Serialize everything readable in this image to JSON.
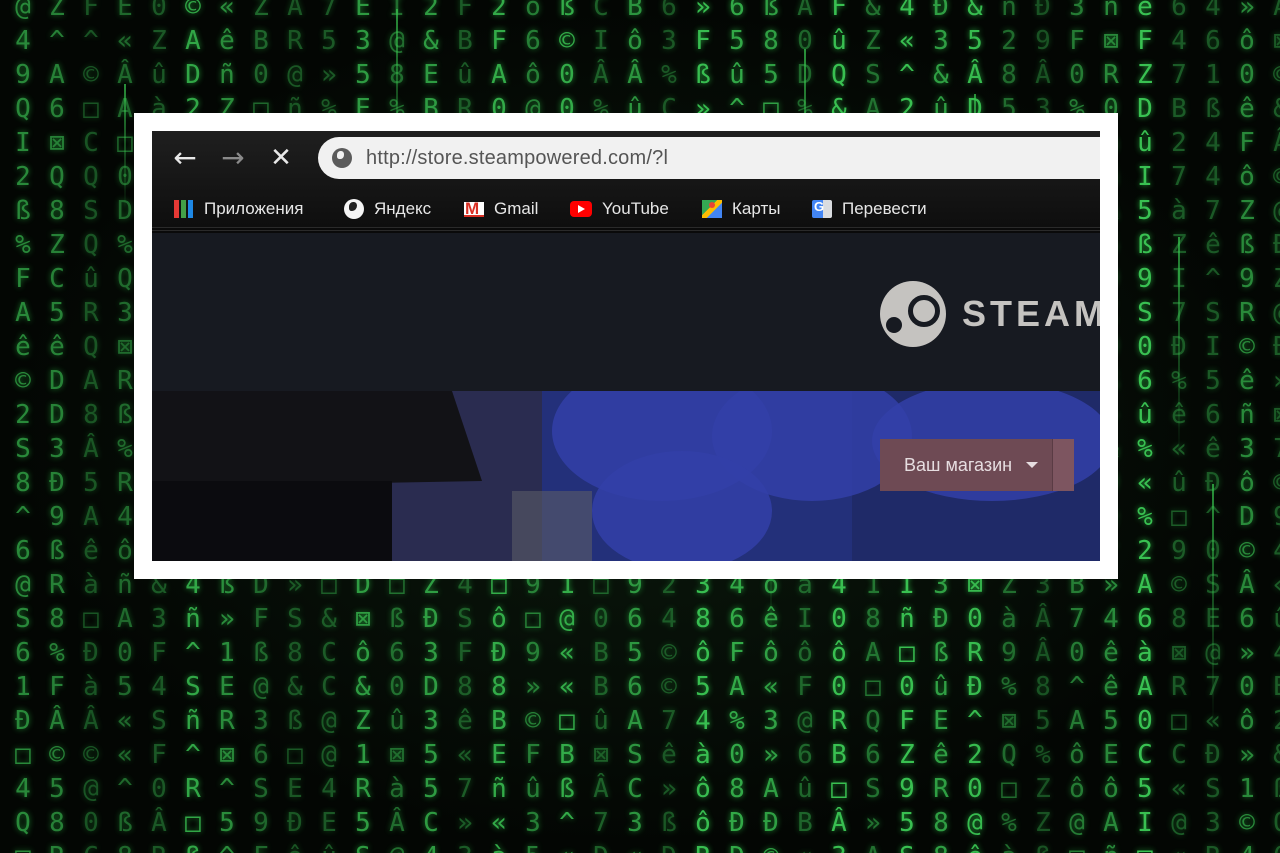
{
  "browser": {
    "url": "http://store.steampowered.com/?l",
    "nav": {
      "back_icon": "arrow-left-icon",
      "forward_icon": "arrow-right-icon",
      "stop_icon": "close-icon"
    },
    "bookmarks": [
      {
        "label": "Приложения",
        "icon": "apps-grid-icon"
      },
      {
        "label": "Яндекс",
        "icon": "yandex-globe-icon"
      },
      {
        "label": "Gmail",
        "icon": "gmail-icon"
      },
      {
        "label": "YouTube",
        "icon": "youtube-icon"
      },
      {
        "label": "Карты",
        "icon": "maps-icon"
      },
      {
        "label": "Перевести",
        "icon": "translate-icon"
      }
    ]
  },
  "steam": {
    "wordmark": "STEAM",
    "store_menu_label": "Ваш магазин"
  },
  "colors": {
    "steam_header_bg": "#171a21",
    "store_menu_bg": "#6e4a54",
    "matrix_green": "#3fd45a"
  }
}
